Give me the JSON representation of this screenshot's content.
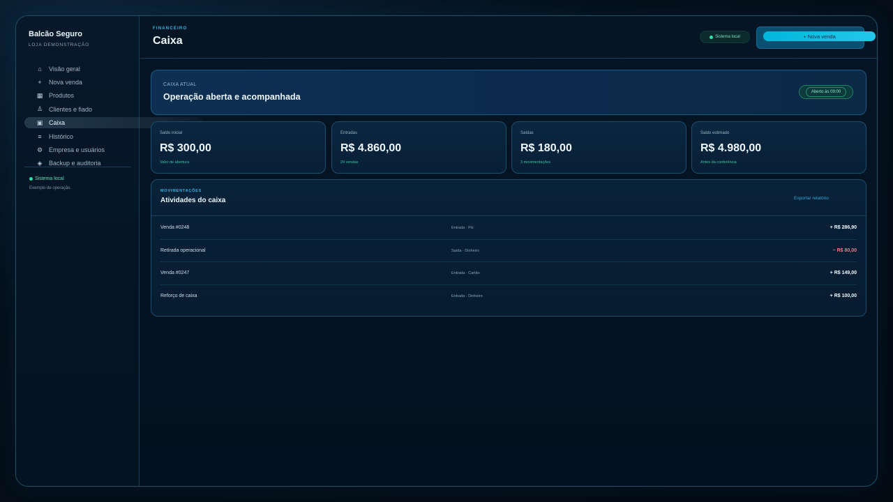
{
  "brand": {
    "title": "Balcão Seguro",
    "subtitle": "LOJA DEMONSTRAÇÃO"
  },
  "sidebar": {
    "items": [
      {
        "label": "Visão geral",
        "icon": "home-icon",
        "glyph": "⌂"
      },
      {
        "label": "Nova venda",
        "icon": "plus-icon",
        "glyph": "+"
      },
      {
        "label": "Produtos",
        "icon": "grid-icon",
        "glyph": "▦"
      },
      {
        "label": "Clientes e fiado",
        "icon": "person-icon",
        "glyph": "♙"
      },
      {
        "label": "Caixa",
        "icon": "register-icon",
        "glyph": "▣",
        "active": true
      },
      {
        "label": "Histórico",
        "icon": "list-icon",
        "glyph": "≡"
      },
      {
        "label": "Empresa e usuários",
        "icon": "gear-icon",
        "glyph": "⚙"
      },
      {
        "label": "Backup e auditoria",
        "icon": "shield-icon",
        "glyph": "◈"
      }
    ],
    "status": "Sistema local",
    "note": "Exemplo de operação."
  },
  "header": {
    "eyebrow": "FINANCEIRO",
    "title": "Caixa",
    "status": "Sistema local",
    "new_sale": "+ Nova venda"
  },
  "hero": {
    "eyebrow": "CAIXA ATUAL",
    "title": "Operação aberta e acompanhada",
    "badge": "Aberto às 09:00"
  },
  "stats": [
    {
      "label": "Saldo inicial",
      "value": "R$ 300,00",
      "hint": "Valor de abertura"
    },
    {
      "label": "Entradas",
      "value": "R$ 4.860,00",
      "hint": "24 vendas"
    },
    {
      "label": "Saídas",
      "value": "R$ 180,00",
      "hint": "3 movimentações"
    },
    {
      "label": "Saldo estimado",
      "value": "R$ 4.980,00",
      "hint": "Antes da conferência"
    }
  ],
  "activities": {
    "eyebrow": "MOVIMENTAÇÕES",
    "title": "Atividades do caixa",
    "export": "Exportar relatório",
    "rows": [
      {
        "desc": "Venda #0248",
        "type": "Entrada · Pix",
        "amount": "+ R$ 286,90",
        "negative": false
      },
      {
        "desc": "Retirada operacional",
        "type": "Saída · Dinheiro",
        "amount": "− R$ 80,00",
        "negative": true
      },
      {
        "desc": "Venda #0247",
        "type": "Entrada · Cartão",
        "amount": "+ R$ 149,00",
        "negative": false
      },
      {
        "desc": "Reforço de caixa",
        "type": "Entrada · Dinheiro",
        "amount": "+ R$ 100,00",
        "negative": false
      }
    ]
  },
  "colors": {
    "accent": "#00b6db",
    "positive": "#2fe0a8",
    "negative": "#f07a8a"
  }
}
